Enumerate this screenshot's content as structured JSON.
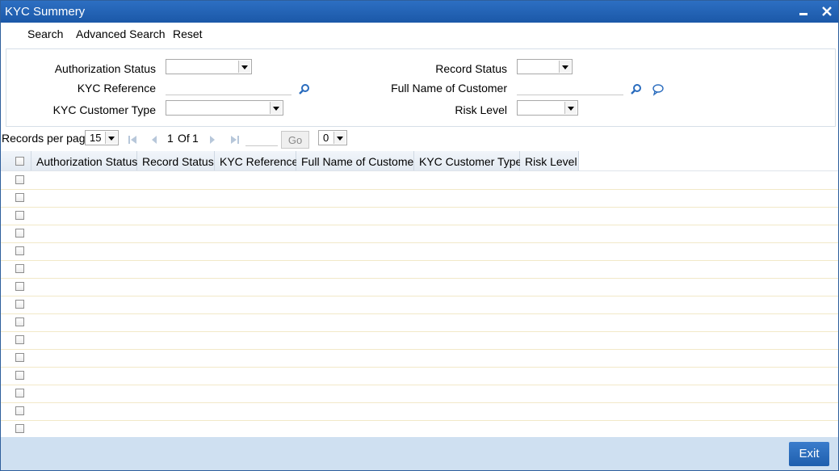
{
  "window": {
    "title": "KYC Summery"
  },
  "menu": {
    "search": "Search",
    "advanced_search": "Advanced Search",
    "reset": "Reset"
  },
  "criteria": {
    "authorization_status_label": "Authorization Status",
    "kyc_reference_label": "KYC Reference",
    "kyc_customer_type_label": "KYC Customer Type",
    "record_status_label": "Record Status",
    "full_name_label": "Full Name of Customer",
    "risk_level_label": "Risk Level",
    "authorization_status_value": "",
    "kyc_reference_value": "",
    "kyc_customer_type_value": "",
    "record_status_value": "",
    "full_name_value": "",
    "risk_level_value": ""
  },
  "pager": {
    "records_per_page_label": "Records per page",
    "records_per_page_value": "15",
    "current_page": "1",
    "of_label": "Of",
    "total_pages": "1",
    "go_label": "Go",
    "jump_value": "",
    "extra_select_value": "0"
  },
  "grid": {
    "columns": [
      "Authorization Status",
      "Record Status",
      "KYC Reference",
      "Full Name of Customer",
      "KYC Customer Type",
      "Risk Level"
    ],
    "row_count": 15
  },
  "footer": {
    "exit_label": "Exit"
  },
  "colors": {
    "titlebar": "#1b58a8",
    "footer": "#cfe0f1",
    "exit_button": "#2a6cbe"
  }
}
